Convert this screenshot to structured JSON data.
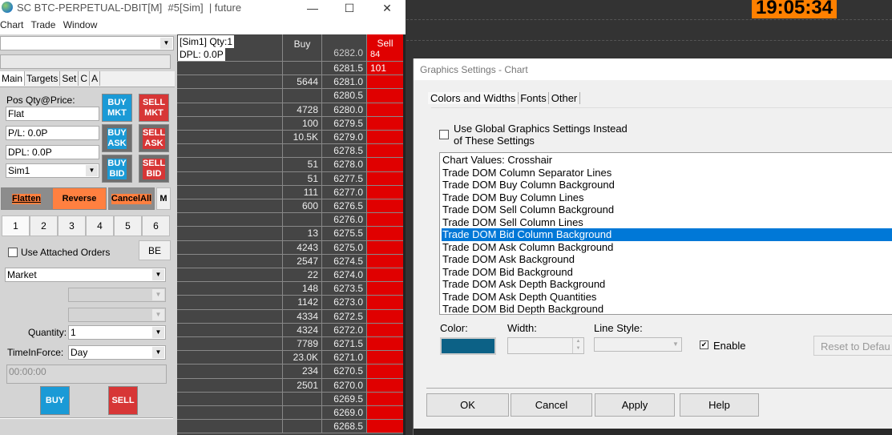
{
  "window": {
    "title": "SC BTC-PERPETUAL-DBIT[M]  #5[Sim]  | future",
    "minimize": "—",
    "maximize": "☐",
    "close": "✕"
  },
  "menu": [
    "Chart",
    "Trade",
    "Window"
  ],
  "panel": {
    "tabs": [
      "Main",
      "Targets",
      "Set",
      "C",
      "A"
    ],
    "pos_label": "Pos Qty@Price:",
    "pos_value": "Flat",
    "pl": "P/L: 0.0P",
    "dpl": "DPL: 0.0P",
    "account": "Sim1",
    "buy_mkt": [
      "BUY",
      "MKT"
    ],
    "sell_mkt": [
      "SELL",
      "MKT"
    ],
    "buy_ask": [
      "BUY",
      "ASK"
    ],
    "sell_ask": [
      "SELL",
      "ASK"
    ],
    "buy_bid": [
      "BUY",
      "BID"
    ],
    "sell_bid": [
      "SELL",
      "BID"
    ],
    "flatten": "Flatten",
    "reverse": "Reverse",
    "cancel_all": "CancelAll",
    "m": "M",
    "qty_presets": [
      "1",
      "2",
      "3",
      "4",
      "5",
      "6"
    ],
    "use_attached": "Use Attached Orders",
    "be": "BE",
    "order_type": "Market",
    "quantity_label": "Quantity:",
    "quantity": "1",
    "tif_label": "TimeInForce:",
    "tif": "Day",
    "time": "00:00:00",
    "buy": "BUY",
    "sell": "SELL",
    "colors": {
      "buy": "#1a9ad6",
      "sell": "#d73636",
      "orange": "#ff8040"
    }
  },
  "dom": {
    "info1": "[Sim1]  Qty:1",
    "info2": "DPL: 0.0P",
    "buy_header": "Buy",
    "sell_header": "Sell",
    "top_partial": {
      "price": "6282.0",
      "sell": "84"
    },
    "rows": [
      {
        "buy": "",
        "price": "6281.5",
        "sell": "101"
      },
      {
        "buy": "5644",
        "price": "6281.0",
        "sell": ""
      },
      {
        "buy": "",
        "price": "6280.5",
        "sell": ""
      },
      {
        "buy": "4728",
        "price": "6280.0",
        "sell": ""
      },
      {
        "buy": "100",
        "price": "6279.5",
        "sell": ""
      },
      {
        "buy": "10.5K",
        "price": "6279.0",
        "sell": ""
      },
      {
        "buy": "",
        "price": "6278.5",
        "sell": ""
      },
      {
        "buy": "51",
        "price": "6278.0",
        "sell": ""
      },
      {
        "buy": "51",
        "price": "6277.5",
        "sell": ""
      },
      {
        "buy": "111",
        "price": "6277.0",
        "sell": ""
      },
      {
        "buy": "600",
        "price": "6276.5",
        "sell": ""
      },
      {
        "buy": "",
        "price": "6276.0",
        "sell": ""
      },
      {
        "buy": "13",
        "price": "6275.5",
        "sell": ""
      },
      {
        "buy": "4243",
        "price": "6275.0",
        "sell": ""
      },
      {
        "buy": "2547",
        "price": "6274.5",
        "sell": ""
      },
      {
        "buy": "22",
        "price": "6274.0",
        "sell": ""
      },
      {
        "buy": "148",
        "price": "6273.5",
        "sell": ""
      },
      {
        "buy": "1142",
        "price": "6273.0",
        "sell": ""
      },
      {
        "buy": "4334",
        "price": "6272.5",
        "sell": ""
      },
      {
        "buy": "4324",
        "price": "6272.0",
        "sell": ""
      },
      {
        "buy": "7789",
        "price": "6271.5",
        "sell": ""
      },
      {
        "buy": "23.0K",
        "price": "6271.0",
        "sell": ""
      },
      {
        "buy": "234",
        "price": "6270.5",
        "sell": ""
      },
      {
        "buy": "2501",
        "price": "6270.0",
        "sell": ""
      },
      {
        "buy": "",
        "price": "6269.5",
        "sell": ""
      },
      {
        "buy": "",
        "price": "6269.0",
        "sell": ""
      },
      {
        "buy": "",
        "price": "6268.5",
        "sell": ""
      }
    ]
  },
  "clock": "19:05:34",
  "dialog": {
    "title": "Graphics Settings  - Chart",
    "tabs": [
      "Colors and Widths",
      "Fonts",
      "Other"
    ],
    "use_global": [
      "Use Global Graphics Settings Instead",
      "of These Settings"
    ],
    "items": [
      "Chart Values: Crosshair",
      "Trade DOM Column Separator Lines",
      "Trade DOM Buy Column Background",
      "Trade DOM Buy Column Lines",
      "Trade DOM Sell Column Background",
      "Trade DOM Sell Column Lines",
      "Trade DOM Bid Column Background",
      "Trade DOM Ask Column Background",
      "Trade DOM Ask Background",
      "Trade DOM Bid Background",
      "Trade DOM Ask Depth Background",
      "Trade DOM Ask Depth Quantities",
      "Trade DOM Bid Depth Background"
    ],
    "selected_index": 6,
    "color_label": "Color:",
    "width_label": "Width:",
    "line_style_label": "Line Style:",
    "enable": "Enable",
    "enable_checked": true,
    "reset": "Reset to Defau",
    "selected_color": "#0c6186",
    "ok": "OK",
    "cancel": "Cancel",
    "apply": "Apply",
    "help": "Help"
  }
}
